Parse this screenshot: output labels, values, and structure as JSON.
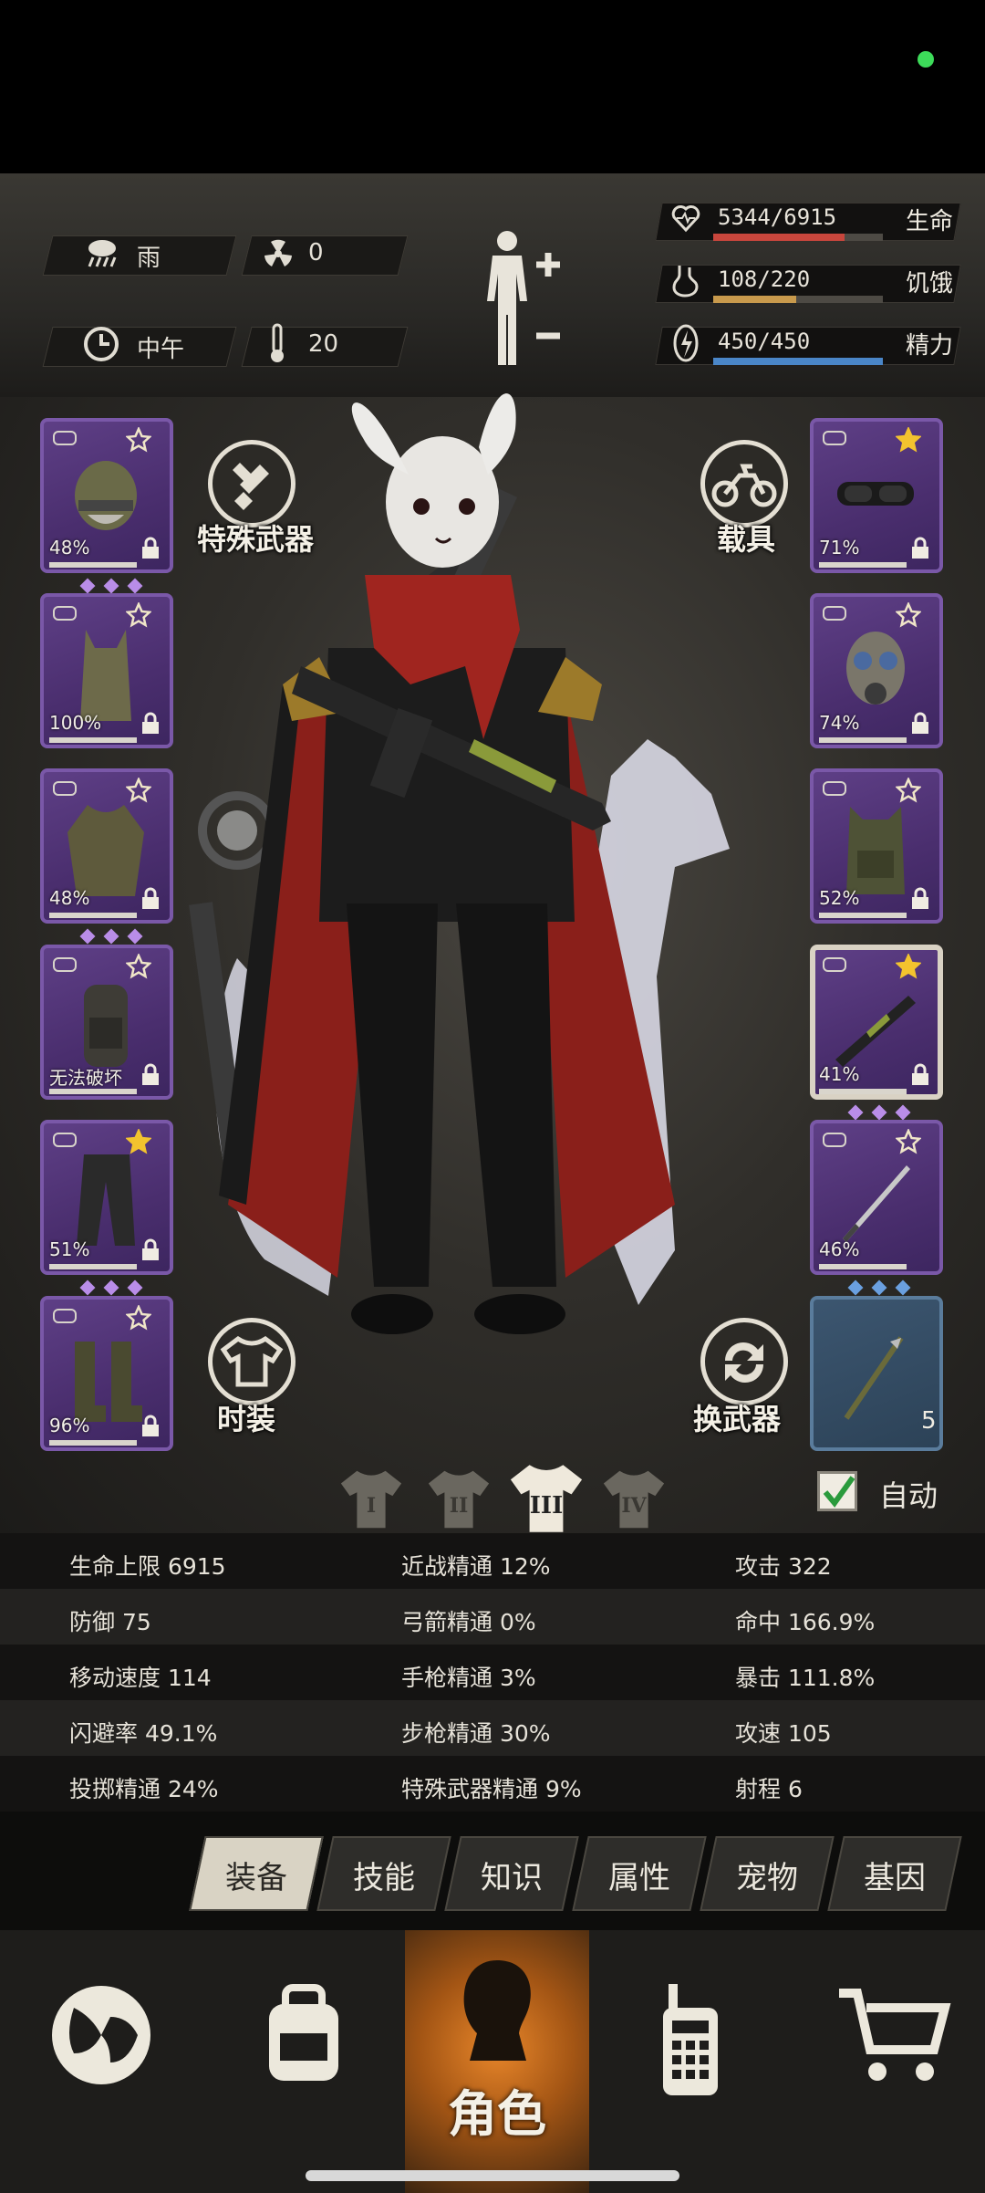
{
  "header": {
    "weather": "雨",
    "radiation": "0",
    "time_of_day": "中午",
    "temperature": "20",
    "stats": [
      {
        "name": "生命",
        "value": "5344/6915",
        "ratio": 0.773,
        "color": "#c8463c",
        "icon": "heart-icon"
      },
      {
        "name": "饥饿",
        "value": "108/220",
        "ratio": 0.49,
        "color": "#c89a4c",
        "icon": "stomach-icon"
      },
      {
        "name": "精力",
        "value": "450/450",
        "ratio": 1.0,
        "color": "#4a86c8",
        "icon": "energy-icon"
      }
    ]
  },
  "left_slots": [
    {
      "item": "helmet",
      "percent": "48%",
      "has_gems": true,
      "gems": 3,
      "locked": true
    },
    {
      "item": "vest",
      "percent": "100%",
      "has_gems": false,
      "locked": true
    },
    {
      "item": "jacket",
      "percent": "48%",
      "has_gems": true,
      "gems": 3,
      "locked": true
    },
    {
      "item": "backpack",
      "percent": "无法破坏",
      "has_gems": false,
      "locked": true
    },
    {
      "item": "pants",
      "percent": "51%",
      "has_gems": true,
      "gems": 3,
      "locked": true
    },
    {
      "item": "boots",
      "percent": "96%",
      "has_gems": false,
      "locked": true
    }
  ],
  "right_slots": [
    {
      "item": "goggles",
      "percent": "71%",
      "star": "gold",
      "locked": true
    },
    {
      "item": "gas-mask",
      "percent": "74%",
      "star": "outline",
      "locked": true
    },
    {
      "item": "armor-vest",
      "percent": "52%",
      "star": "outline",
      "locked": true
    },
    {
      "item": "rifle",
      "percent": "41%",
      "star": "gold",
      "locked": true,
      "selected": true,
      "gems": 3
    },
    {
      "item": "sword",
      "percent": "46%",
      "star": "outline",
      "locked": false,
      "gems": 3,
      "gem_color": "blue"
    },
    {
      "item": "arrow",
      "count": "5",
      "blue": true
    }
  ],
  "buttons": {
    "special_weapon": "特殊武器",
    "vehicle": "载具",
    "outfit": "时装",
    "swap_weapon": "换武器",
    "auto": "自动"
  },
  "outfit_sets": [
    "I",
    "II",
    "III",
    "IV"
  ],
  "active_outfit": 2,
  "stats_table": [
    [
      "生命上限 6915",
      "近战精通 12%",
      "攻击 322"
    ],
    [
      "防御 75",
      "弓箭精通 0%",
      "命中 166.9%"
    ],
    [
      "移动速度 114",
      "手枪精通 3%",
      "暴击 111.8%"
    ],
    [
      "闪避率 49.1%",
      "步枪精通 30%",
      "攻速 105"
    ],
    [
      "投掷精通 24%",
      "特殊武器精通 9%",
      "射程 6"
    ]
  ],
  "tabs": [
    "装备",
    "技能",
    "知识",
    "属性",
    "宠物",
    "基因"
  ],
  "active_tab": 0,
  "bottom_nav": [
    {
      "icon": "globe-icon",
      "label": ""
    },
    {
      "icon": "backpack-icon",
      "label": ""
    },
    {
      "icon": "character-icon",
      "label": "角色"
    },
    {
      "icon": "radio-icon",
      "label": ""
    },
    {
      "icon": "cart-icon",
      "label": ""
    }
  ]
}
